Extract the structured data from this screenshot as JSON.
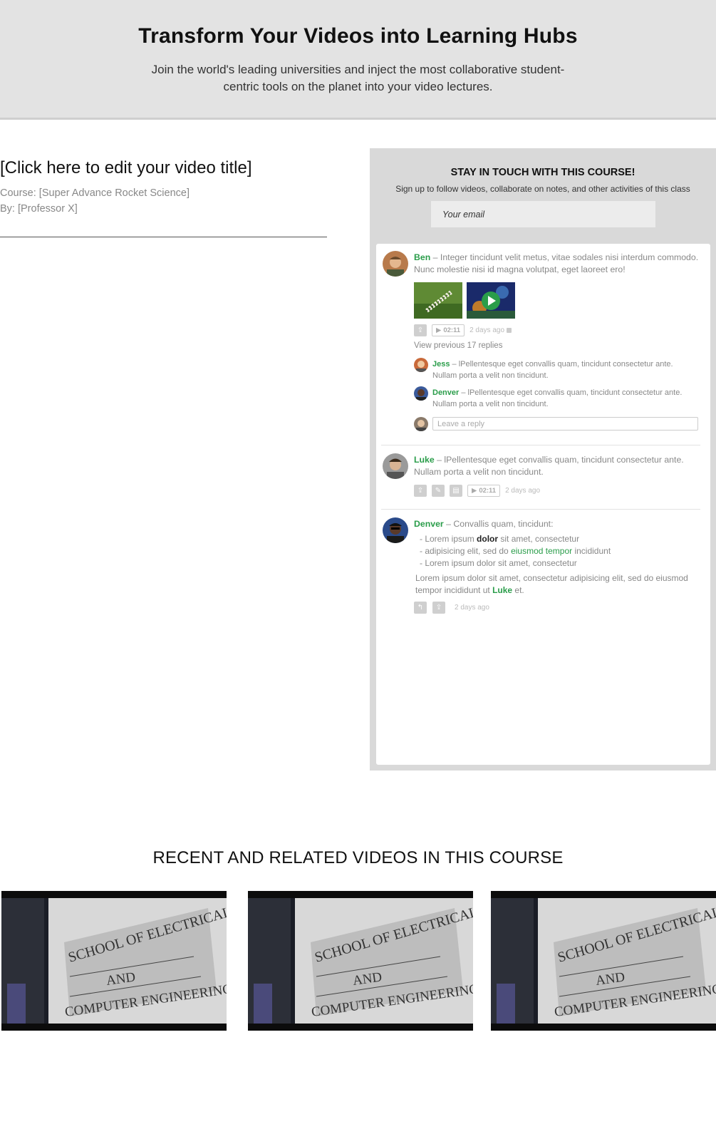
{
  "hero": {
    "title": "Transform Your Videos into Learning Hubs",
    "subtitle": "Join the world's leading universities and inject the most collaborative student-centric tools on the planet into your video lectures."
  },
  "video": {
    "title": "[Click here to edit your video title]",
    "course": "Course: [Super Advance Rocket Science]",
    "by": "By: [Professor X]"
  },
  "signup": {
    "title": "STAY IN TOUCH WITH THIS COURSE!",
    "subtitle": "Sign up to follow videos, collaborate on notes, and other activities of this class",
    "email_placeholder": "Your email"
  },
  "feed": {
    "post1": {
      "name": "Ben",
      "text": " – Integer tincidunt velit metus, vitae sodales nisi interdum commodo. Nunc molestie nisi id magna volutpat, eget laoreet ero!",
      "timestamp": "02:11",
      "time_ago": "2 days ago",
      "view_previous": "View previous 17 replies",
      "replies": [
        {
          "name": "Jess",
          "text": " – lPellentesque eget convallis quam, tincidunt consectetur ante. Nullam porta a velit non tincidunt."
        },
        {
          "name": "Denver",
          "text": " – lPellentesque eget convallis quam, tincidunt consectetur ante. Nullam porta a velit non tincidunt."
        }
      ],
      "reply_placeholder": "Leave a reply"
    },
    "post2": {
      "name": "Luke",
      "text": " – lPellentesque eget convallis quam, tincidunt consectetur ante. Nullam porta a velit non tincidunt.",
      "timestamp": "02:11",
      "time_ago": "2 days ago"
    },
    "post3": {
      "name": "Denver",
      "intro": " – Convallis quam, tincidunt:",
      "bullet1_a": "- Lorem ipsum ",
      "bullet1_b": "dolor",
      "bullet1_c": " sit amet, consectetur",
      "bullet2_a": "- adipisicing elit, sed do ",
      "bullet2_b": "eiusmod tempor",
      "bullet2_c": " incididunt",
      "bullet3": "- Lorem ipsum dolor sit amet, consectetur",
      "para_a": "Lorem ipsum dolor sit amet, consectetur adipisicing elit, sed do eiusmod tempor incididunt ut ",
      "para_mention": "Luke",
      "para_c": " et.",
      "time_ago": "2 days ago"
    }
  },
  "related": {
    "title": "RECENT AND RELATED VIDEOS IN THIS COURSE",
    "sign_line1": "SCHOOL OF ELECTRICAL",
    "sign_line2": "AND",
    "sign_line3": "COMPUTER ENGINEERING"
  },
  "colors": {
    "accent_green": "#2a9d4a",
    "hero_bg": "#e3e3e3",
    "panel_bg": "#d9d9d9"
  },
  "icons": [
    "share-icon",
    "play-icon",
    "lock-icon",
    "edit-icon",
    "trash-icon",
    "reply-icon"
  ]
}
